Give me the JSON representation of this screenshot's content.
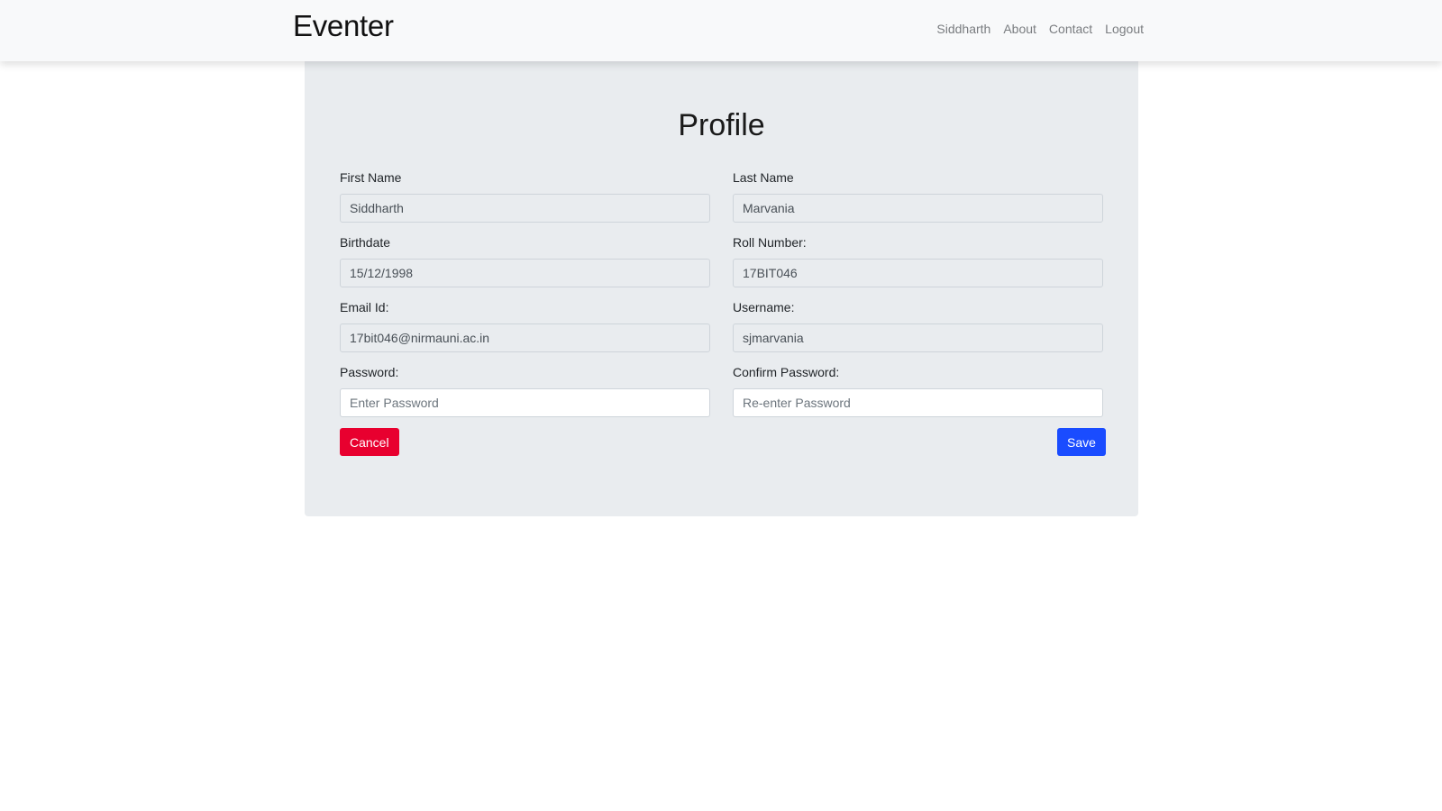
{
  "navbar": {
    "brand": "Eventer",
    "links": [
      {
        "label": "Siddharth"
      },
      {
        "label": "About"
      },
      {
        "label": "Contact"
      },
      {
        "label": "Logout"
      }
    ]
  },
  "profile": {
    "title": "Profile",
    "fields": {
      "first_name": {
        "label": "First Name",
        "value": "Siddharth"
      },
      "last_name": {
        "label": "Last Name",
        "value": "Marvania"
      },
      "birthdate": {
        "label": "Birthdate",
        "value": "15/12/1998"
      },
      "roll_number": {
        "label": "Roll Number:",
        "value": "17BIT046"
      },
      "email": {
        "label": "Email Id:",
        "value": "17bit046@nirmauni.ac.in"
      },
      "username": {
        "label": "Username:",
        "value": "sjmarvania"
      },
      "password": {
        "label": "Password:",
        "value": "",
        "placeholder": "Enter Password"
      },
      "confirm_password": {
        "label": "Confirm Password:",
        "value": "",
        "placeholder": "Re-enter Password"
      }
    },
    "buttons": {
      "cancel": "Cancel",
      "save": "Save"
    }
  },
  "colors": {
    "navbar_bg": "#f8f9fa",
    "panel_bg": "#e9ecef",
    "cancel": "#e8002f",
    "save": "#1a4cff"
  }
}
